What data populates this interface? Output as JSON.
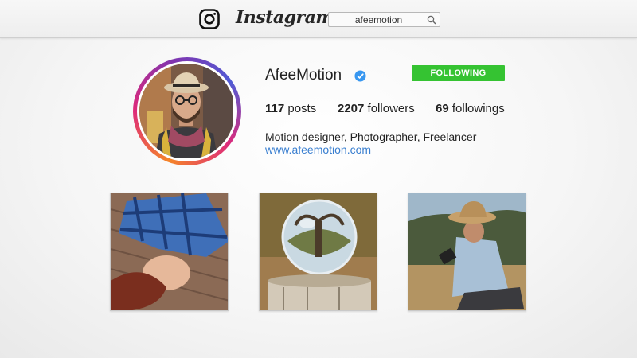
{
  "header": {
    "logo_text": "Instagram",
    "search_value": "afeemotion"
  },
  "profile": {
    "username": "AfeeMotion",
    "follow_label": "FOLLOWING",
    "posts_count": "117",
    "posts_label": "posts",
    "followers_count": "2207",
    "followers_label": "followers",
    "followings_count": "69",
    "followings_label": "followings",
    "bio": "Motion designer, Photographer, Freelancer",
    "website": "www.afeemotion.com"
  },
  "colors": {
    "follow_button": "#35c332",
    "link": "#3a7fd0",
    "verified": "#3897f0"
  },
  "icons": {
    "logo": "instagram-camera-icon",
    "search": "search-icon",
    "verified": "verified-badge-icon"
  }
}
